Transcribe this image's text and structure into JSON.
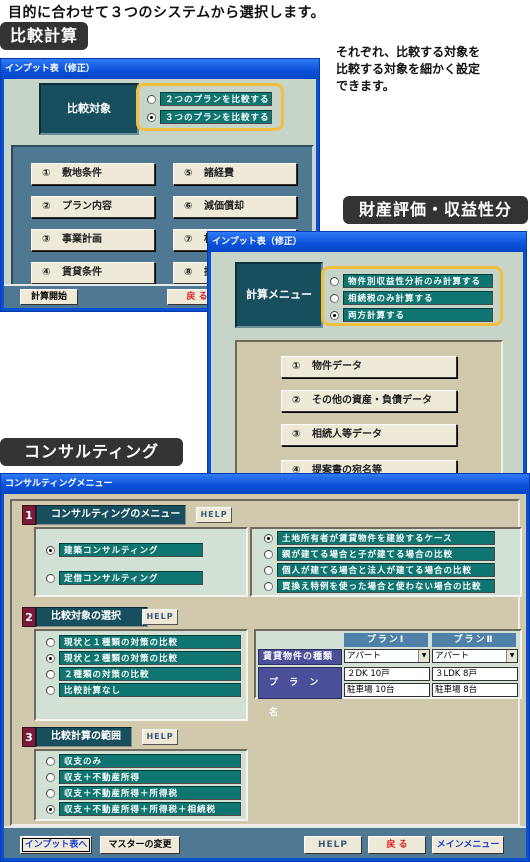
{
  "headline": "目的に合わせて３つのシステムから選択します。",
  "labels": {
    "comparison": "比較計算",
    "asset": "財産評価・収益性分析",
    "consulting": "コンサルティング"
  },
  "description": [
    "それぞれ、比較する対象を",
    "比較する対象を細かく設定",
    "できます。"
  ],
  "window1": {
    "title": "インプット表（修正）",
    "target_label": "比較対象",
    "options": [
      {
        "label": "２つのプランを比較する",
        "selected": false
      },
      {
        "label": "３つのプランを比較する",
        "selected": true
      }
    ],
    "buttons": [
      {
        "num": "①",
        "label": "敷地条件"
      },
      {
        "num": "②",
        "label": "プラン内容"
      },
      {
        "num": "③",
        "label": "事業計画"
      },
      {
        "num": "④",
        "label": "賃貸条件"
      },
      {
        "num": "⑤",
        "label": "諸経費"
      },
      {
        "num": "⑥",
        "label": "減価償却"
      },
      {
        "num": "⑦",
        "label": "相続税関連"
      },
      {
        "num": "⑧",
        "label": "提"
      }
    ],
    "start_label": "計算開始",
    "back_label": "戻 る"
  },
  "window2": {
    "title": "インプット表（修正）",
    "menu_label": "計算メニュー",
    "options": [
      {
        "label": "物件別収益性分析のみ計算する",
        "selected": false
      },
      {
        "label": "相続税のみ計算する",
        "selected": false
      },
      {
        "label": "両方計算する",
        "selected": true
      }
    ],
    "buttons": [
      {
        "num": "①",
        "label": "物件データ"
      },
      {
        "num": "②",
        "label": "その他の資産・負債データ"
      },
      {
        "num": "③",
        "label": "相続人等データ"
      },
      {
        "num": "④",
        "label": "提案書の宛名等"
      }
    ]
  },
  "window3": {
    "title": "コンサルティングメニュー",
    "help_label": "HELP",
    "section1": {
      "num": "1",
      "title": "コンサルティングのメニュー",
      "left_options": [
        {
          "label": "建築コンサルティング",
          "selected": true
        },
        {
          "label": "定借コンサルティング",
          "selected": false
        }
      ],
      "right_options": [
        {
          "label": "土地所有者が賃貸物件を建設するケース",
          "selected": true
        },
        {
          "label": "親が建てる場合と子が建てる場合の比較",
          "selected": false
        },
        {
          "label": "個人が建てる場合と法人が建てる場合の比較",
          "selected": false
        },
        {
          "label": "買換え特例を使った場合と使わない場合の比較",
          "selected": false
        }
      ]
    },
    "section2": {
      "num": "2",
      "title": "比較対象の選択",
      "options": [
        {
          "label": "現状と１種類の対策の比較",
          "selected": false
        },
        {
          "label": "現状と２種類の対策の比較",
          "selected": true
        },
        {
          "label": "２種類の対策の比較",
          "selected": false
        },
        {
          "label": "比較計算なし",
          "selected": false
        }
      ],
      "grid": {
        "columns": [
          "プランⅠ",
          "プランⅡ"
        ],
        "row_type_label": "賃貸物件の種類",
        "row_name_label": "プ ラ ン 名",
        "types": [
          "アパート",
          "アパート"
        ],
        "names_line1": [
          "２DK 10戸",
          "３LDK 8戸"
        ],
        "names_line2": [
          "駐車場 10台",
          "駐車場 8台"
        ]
      }
    },
    "section3": {
      "num": "3",
      "title": "比較計算の範囲",
      "options": [
        {
          "label": "収支のみ",
          "selected": false
        },
        {
          "label": "収支＋不動産所得",
          "selected": false
        },
        {
          "label": "収支＋不動産所得＋所得税",
          "selected": false
        },
        {
          "label": "収支＋不動産所得＋所得税＋相続税",
          "selected": true
        }
      ]
    },
    "footer": {
      "input_label": "インプット表へ",
      "master_label": "マスターの変更",
      "help_label": "HELP",
      "back_label": "戻 る",
      "main_label": "メインメニュー"
    }
  },
  "colors": {
    "titlebar": "#0a50d8",
    "teal_label": "#0f7571",
    "dark_teal": "#174f5e",
    "orange_frame": "#f3bf3e",
    "back_text": "#e02020",
    "main_text": "#1a3fd0"
  }
}
